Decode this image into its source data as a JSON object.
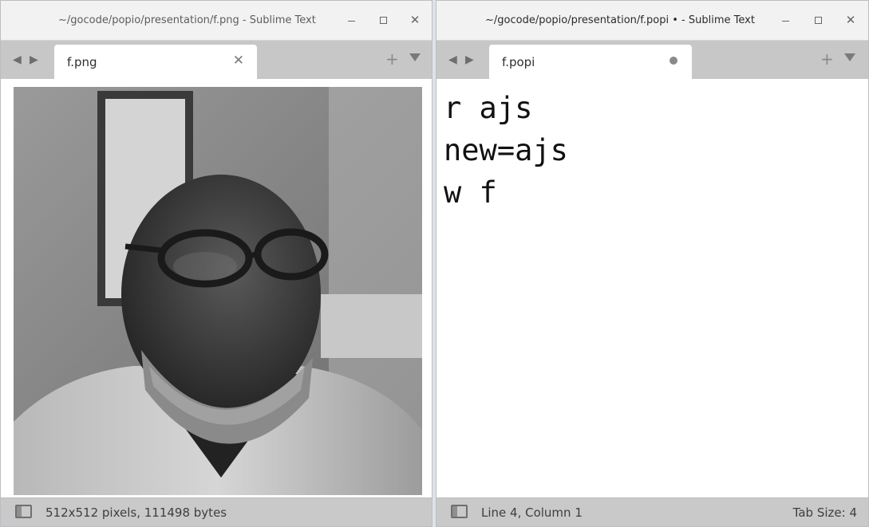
{
  "left_window": {
    "title": "~/gocode/popio/presentation/f.png - Sublime Text",
    "tab": {
      "label": "f.png"
    },
    "image": {
      "description_icon": "portrait-photo",
      "alt": "f.png"
    },
    "status": {
      "text": "512x512 pixels, 111498 bytes"
    }
  },
  "right_window": {
    "title": "~/gocode/popio/presentation/f.popi • - Sublime Text",
    "tab": {
      "label": "f.popi",
      "modified": true
    },
    "code_lines": [
      "r ajs",
      "new=ajs",
      "w f"
    ],
    "status": {
      "position": "Line 4, Column 1",
      "tab_size": "Tab Size: 4"
    }
  },
  "icons": {
    "nav_back": "◀",
    "nav_fwd": "▶",
    "close": "✕",
    "add": "+"
  },
  "colors": {
    "tabbar": "#c7c7c7",
    "statusbar": "#c9c9c9",
    "titlebar": "#f2f2f2"
  }
}
